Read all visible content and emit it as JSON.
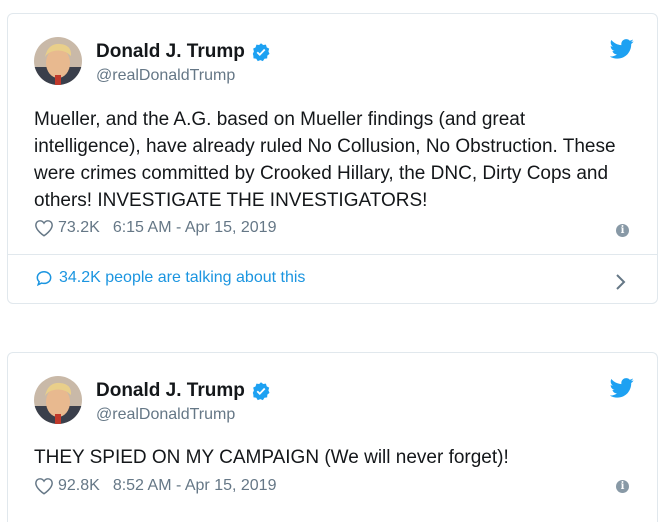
{
  "tweets": [
    {
      "display_name": "Donald J. Trump",
      "handle": "@realDonaldTrump",
      "text": "Mueller, and the A.G. based on Mueller findings (and great intelligence), have already ruled No Collusion, No Obstruction. These were crimes committed by Crooked Hillary, the DNC, Dirty Cops and others! INVESTIGATE THE INVESTIGATORS!",
      "likes": "73.2K",
      "timestamp": "6:15 AM - Apr 15, 2019",
      "talking": "34.2K people are talking about this"
    },
    {
      "display_name": "Donald J. Trump",
      "handle": "@realDonaldTrump",
      "text": "THEY SPIED ON MY CAMPAIGN (We will never forget)!",
      "likes": "92.8K",
      "timestamp": "8:52 AM - Apr 15, 2019"
    }
  ],
  "icons": {
    "verified": "verified-badge-icon",
    "bird": "twitter-bird-icon",
    "heart": "heart-icon",
    "info": "info-icon",
    "bubble": "speech-bubble-icon",
    "chevron": "chevron-right-icon"
  },
  "colors": {
    "accent": "#1da1f2",
    "link": "#1b95e0",
    "secondary_text": "#657786",
    "border": "#e1e8ed"
  }
}
